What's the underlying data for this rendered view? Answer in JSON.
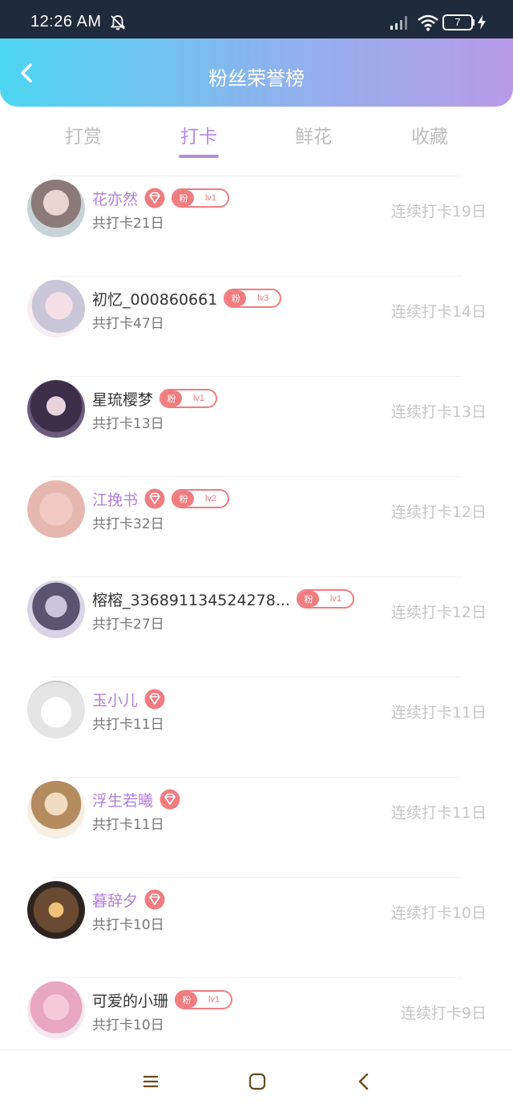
{
  "status_bar": {
    "time": "12:26 AM",
    "battery": "7"
  },
  "header": {
    "title": "粉丝荣誉榜"
  },
  "tabs": [
    {
      "label": "打赏",
      "active": false
    },
    {
      "label": "打卡",
      "active": true
    },
    {
      "label": "鲜花",
      "active": false
    },
    {
      "label": "收藏",
      "active": false
    }
  ],
  "fan_badge_label": "粉",
  "colors": {
    "accent": "#b68be2",
    "badge": "#f07c80",
    "vip_name": "#b27fd8"
  },
  "rows": [
    {
      "name": "花亦然",
      "vip": true,
      "badge_level": "lv1",
      "total": "共打卡21日",
      "streak": "连续打卡19日"
    },
    {
      "name": "初忆_000860661",
      "vip": false,
      "badge_level": "lv3",
      "total": "共打卡47日",
      "streak": "连续打卡14日"
    },
    {
      "name": "星琉樱梦",
      "vip": false,
      "badge_level": "lv1",
      "total": "共打卡13日",
      "streak": "连续打卡13日"
    },
    {
      "name": "江挽书",
      "vip": true,
      "badge_level": "lv2",
      "total": "共打卡32日",
      "streak": "连续打卡12日"
    },
    {
      "name": "榕榕_336891134524278...",
      "vip": false,
      "badge_level": "lv1",
      "total": "共打卡27日",
      "streak": "连续打卡12日"
    },
    {
      "name": "玉小儿",
      "vip": true,
      "badge_level": null,
      "total": "共打卡11日",
      "streak": "连续打卡11日"
    },
    {
      "name": "浮生若曦",
      "vip": true,
      "badge_level": null,
      "total": "共打卡11日",
      "streak": "连续打卡11日"
    },
    {
      "name": "暮辞夕",
      "vip": true,
      "badge_level": null,
      "total": "共打卡10日",
      "streak": "连续打卡10日"
    },
    {
      "name": "可爱的小珊",
      "vip": false,
      "badge_level": "lv1",
      "total": "共打卡10日",
      "streak": "连续打卡9日"
    }
  ]
}
